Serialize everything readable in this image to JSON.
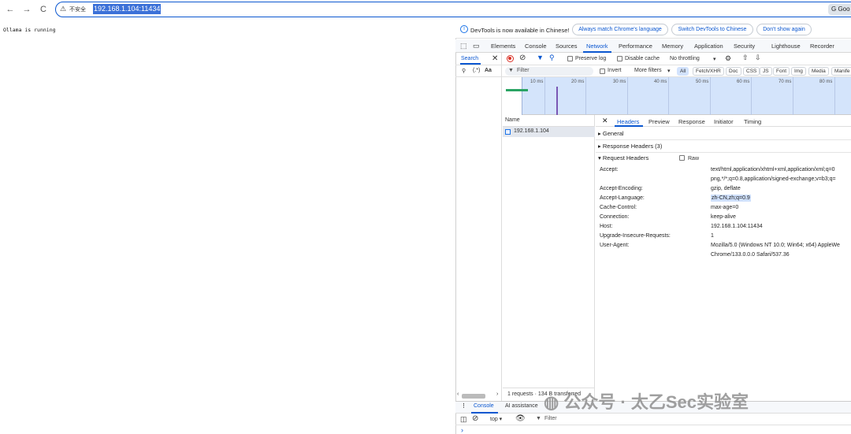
{
  "browser": {
    "back_icon": "←",
    "forward_icon": "→",
    "reload_icon": "C",
    "security_label": "不安全",
    "url": "192.168.1.104:11434",
    "profile_label": "Goo"
  },
  "page": {
    "body_text": "Ollama is running"
  },
  "devtools": {
    "infobar": {
      "message": "DevTools is now available in Chinese!",
      "btn_match": "Always match Chrome's language",
      "btn_switch": "Switch DevTools to Chinese",
      "btn_dont": "Don't show again"
    },
    "tabs": [
      "Elements",
      "Console",
      "Sources",
      "Network",
      "Performance",
      "Memory",
      "Application",
      "Security",
      "Lighthouse",
      "Recorder"
    ],
    "search_tab": "Search",
    "toolbar": {
      "preserve_log": "Preserve log",
      "disable_cache": "Disable cache",
      "throttling": "No throttling"
    },
    "filter": {
      "placeholder": "Filter",
      "invert": "Invert",
      "more_filters": "More filters",
      "types": [
        "All",
        "Fetch/XHR",
        "Doc",
        "CSS",
        "JS",
        "Font",
        "Img",
        "Media",
        "Manife"
      ]
    },
    "search_opts": {
      "regex": "(.*)",
      "case": "Aa"
    },
    "timeline_ticks": [
      "10 ms",
      "20 ms",
      "30 ms",
      "40 ms",
      "50 ms",
      "60 ms",
      "70 ms",
      "80 ms"
    ],
    "name_header": "Name",
    "request_name": "192.168.1.104",
    "detail_tabs": [
      "Headers",
      "Preview",
      "Response",
      "Initiator",
      "Timing"
    ],
    "sections": {
      "general": "General",
      "response_headers": "Response Headers (3)",
      "request_headers": "Request Headers",
      "raw": "Raw"
    },
    "request_headers": [
      {
        "name": "Accept:",
        "value": "text/html,application/xhtml+xml,application/xml;q=0"
      },
      {
        "name": "",
        "value": "png,*/*;q=0.8,application/signed-exchange;v=b3;q="
      },
      {
        "name": "Accept-Encoding:",
        "value": "gzip, deflate"
      },
      {
        "name": "Accept-Language:",
        "value": "zh-CN,zh;q=0.9"
      },
      {
        "name": "Cache-Control:",
        "value": "max-age=0"
      },
      {
        "name": "Connection:",
        "value": "keep-alive"
      },
      {
        "name": "Host:",
        "value": "192.168.1.104:11434"
      },
      {
        "name": "Upgrade-Insecure-Requests:",
        "value": "1"
      },
      {
        "name": "User-Agent:",
        "value": "Mozilla/5.0 (Windows NT 10.0; Win64; x64) AppleWe"
      },
      {
        "name": "",
        "value": "Chrome/133.0.0.0 Safari/537.36"
      }
    ],
    "status_text": "1 requests · 134 B transferred",
    "drawer": {
      "console": "Console",
      "ai": "AI assistance"
    },
    "console": {
      "context": "top",
      "filter": "Filter",
      "prompt": "›"
    }
  },
  "watermark": "公众号 · 太乙Sec实验室",
  "colors": {
    "accent": "#0b57d0",
    "timeline_bg": "#d4e4fb",
    "selected_row": "#e3e7ee"
  }
}
